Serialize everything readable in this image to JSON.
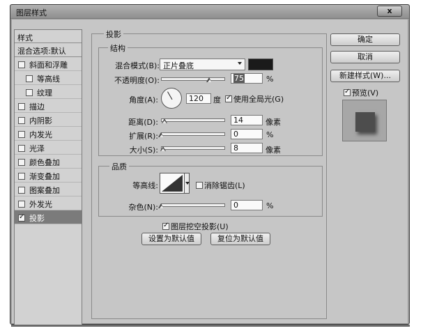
{
  "window": {
    "title": "图层样式",
    "close_label": "x"
  },
  "style_list": {
    "header": "样式",
    "blend_options": "混合选项:默认",
    "items": [
      {
        "label": "斜面和浮雕",
        "checked": false,
        "sub": false
      },
      {
        "label": "等高线",
        "checked": false,
        "sub": true
      },
      {
        "label": "纹理",
        "checked": false,
        "sub": true
      },
      {
        "label": "描边",
        "checked": false,
        "sub": false
      },
      {
        "label": "内阴影",
        "checked": false,
        "sub": false
      },
      {
        "label": "内发光",
        "checked": false,
        "sub": false
      },
      {
        "label": "光泽",
        "checked": false,
        "sub": false
      },
      {
        "label": "颜色叠加",
        "checked": false,
        "sub": false
      },
      {
        "label": "渐变叠加",
        "checked": false,
        "sub": false
      },
      {
        "label": "图案叠加",
        "checked": false,
        "sub": false
      },
      {
        "label": "外发光",
        "checked": false,
        "sub": false
      },
      {
        "label": "投影",
        "checked": true,
        "sub": false,
        "selected": true
      }
    ]
  },
  "drop_shadow": {
    "title": "投影",
    "structure": {
      "title": "结构",
      "blend_mode_label": "混合模式(B):",
      "blend_mode_value": "正片叠底",
      "shadow_color": "#1a1a1a",
      "opacity_label": "不透明度(O):",
      "opacity_value": "75",
      "opacity_unit": "%",
      "opacity_fraction": 0.75,
      "angle_label": "角度(A):",
      "angle_value": "120",
      "angle_unit": "度",
      "global_light_label": "使用全局光(G)",
      "global_light_checked": true,
      "distance_label": "距离(D):",
      "distance_value": "14",
      "distance_unit": "像素",
      "distance_fraction": 0.05,
      "spread_label": "扩展(R):",
      "spread_value": "0",
      "spread_unit": "%",
      "spread_fraction": 0.0,
      "size_label": "大小(S):",
      "size_value": "8",
      "size_unit": "像素",
      "size_fraction": 0.03
    },
    "quality": {
      "title": "品质",
      "contour_label": "等高线:",
      "antialias_label": "消除锯齿(L)",
      "antialias_checked": false,
      "noise_label": "杂色(N):",
      "noise_value": "0",
      "noise_unit": "%",
      "noise_fraction": 0.0
    },
    "knockout_label": "图层挖空投影(U)",
    "knockout_checked": true,
    "make_default_label": "设置为默认值",
    "reset_default_label": "复位为默认值"
  },
  "buttons": {
    "ok": "确定",
    "cancel": "取消",
    "new_style": "新建样式(W)...",
    "preview_label": "预览(V)",
    "preview_checked": true
  }
}
